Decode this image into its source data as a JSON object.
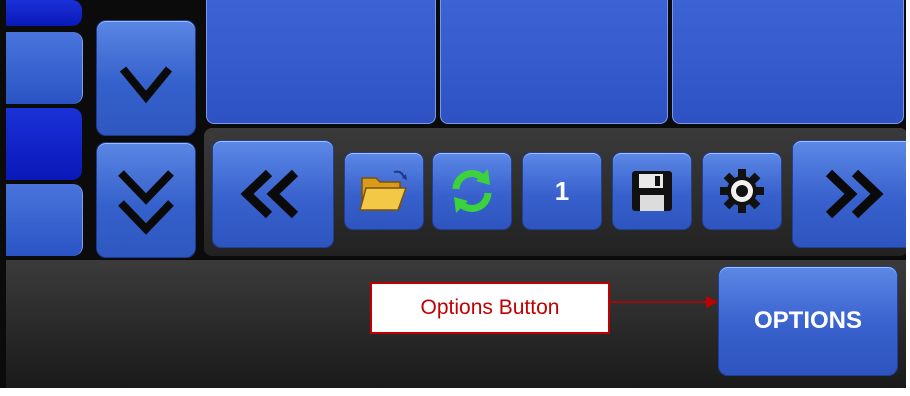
{
  "colors": {
    "accent_blue": "#3861cd",
    "edge_blue": "#0a18b8",
    "background": "#0b0b0b",
    "callout_red": "#c00000"
  },
  "scroll": {
    "down_icon": "chevron-down-icon",
    "double_down_icon": "double-chevron-down-icon"
  },
  "toolbar": {
    "prev_icon": "double-chevron-left-icon",
    "open_icon": "folder-open-icon",
    "refresh_icon": "refresh-icon",
    "page_number": "1",
    "save_icon": "floppy-disk-icon",
    "settings_icon": "gear-icon",
    "next_icon": "double-chevron-right-icon"
  },
  "options": {
    "label": "OPTIONS"
  },
  "annotation": {
    "text": "Options Button"
  }
}
